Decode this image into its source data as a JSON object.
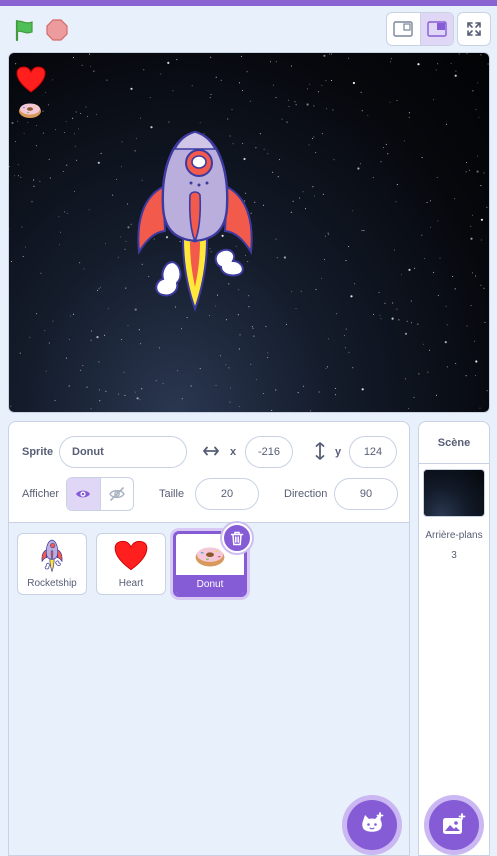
{
  "colors": {
    "accent": "#855cd6",
    "flag": "#4cbf56",
    "stop": "#ec9c9c",
    "heart": "#ff1f1f"
  },
  "toolbar": {
    "green_flag_icon": "green-flag-icon",
    "stop_icon": "stop-sign-icon",
    "small_stage_icon": "small-stage-layout-icon",
    "normal_stage_icon": "normal-stage-layout-icon",
    "fullscreen_icon": "fullscreen-icon"
  },
  "stage": {
    "background": "starfield",
    "sprites_visible": [
      "Heart",
      "Donut",
      "Rocketship"
    ]
  },
  "sprite_info": {
    "sprite_label": "Sprite",
    "sprite_name": "Donut",
    "x_label": "x",
    "x_value": "-216",
    "y_label": "y",
    "y_value": "124",
    "show_label": "Afficher",
    "size_label": "Taille",
    "size_value": "20",
    "direction_label": "Direction",
    "direction_value": "90"
  },
  "sprites": [
    {
      "name": "Rocketship",
      "selected": false
    },
    {
      "name": "Heart",
      "selected": false
    },
    {
      "name": "Donut",
      "selected": true
    }
  ],
  "stage_panel": {
    "title": "Scène",
    "backdrops_label": "Arrière-plans",
    "backdrops_count": "3"
  }
}
